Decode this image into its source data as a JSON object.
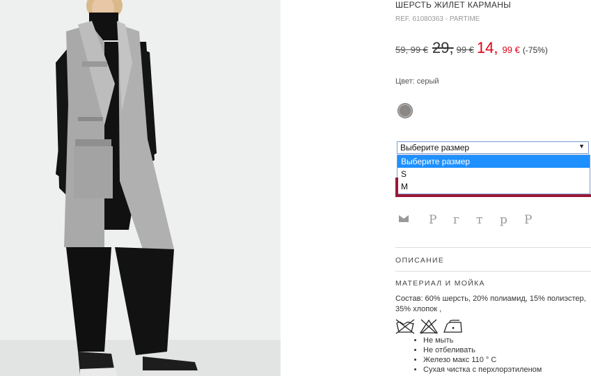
{
  "product": {
    "title": "ШЕРСТЬ ЖИЛЕТ КАРМАНЫ",
    "ref": "REF. 61080363 - PARTIME",
    "price_original": "59, 99 €",
    "price_previous_int": "29,",
    "price_previous_dec": "99 €",
    "price_sale_int": "14,",
    "price_sale_dec": "99 €",
    "discount": "(-75%)",
    "sale_color": "#e10015"
  },
  "color": {
    "label": "Цвет: серый",
    "swatch_hex": "#8a8784"
  },
  "size_select": {
    "selected": "Выберите размер",
    "options": [
      "Выберите размер",
      "S",
      "M"
    ]
  },
  "share": {
    "icons": [
      "mail-icon",
      "pinterest-icon",
      "google-plus-icon",
      "twitter-icon",
      "reddit-icon",
      "pinterest-alt-icon"
    ],
    "glyphs": [
      "P",
      "г",
      "т",
      "р",
      "Р"
    ]
  },
  "description": {
    "heading": "ОПИСАНИЕ"
  },
  "materials": {
    "heading": "МАТЕРИАЛ И МОЙКА",
    "composition": "Состав: 60% шерсть, 20% полиамид, 15% полиэстер, 35% хлопок ,",
    "care": [
      "Не мыть",
      "Не отбеливать",
      "Железо макс 110 ° C",
      "Сухая чистка с перхлорэтиленом"
    ]
  }
}
